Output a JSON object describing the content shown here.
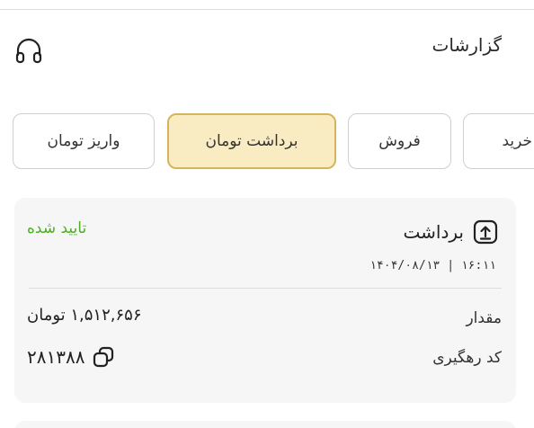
{
  "header": {
    "title": "گزارشات",
    "support_icon": "headphones-icon"
  },
  "tabs": [
    {
      "key": "deposit",
      "label": "واریز تومان",
      "active": false
    },
    {
      "key": "withdraw",
      "label": "برداشت تومان",
      "active": true
    },
    {
      "key": "sale",
      "label": "فروش",
      "active": false
    },
    {
      "key": "buy",
      "label": "خرید",
      "active": false
    }
  ],
  "colors": {
    "active_tab_bg": "#f9ecc3",
    "active_tab_border": "#d5b45c",
    "status_green": "#4caf26",
    "card_bg": "#f6f6f6"
  },
  "transaction": {
    "type_label": "برداشت",
    "type_icon": "upload-arrow-icon",
    "status": "تایید شده",
    "datetime": "۱۴۰۴/۰۸/۱۳ | ۱۶:۱۱",
    "amount_label": "مقدار",
    "amount_value": "۱,۵۱۲,۶۵۶ تومان",
    "code_label": "کد رهگیری",
    "code_value": "۲۸۱۳۸۸",
    "copy_icon": "copy-icon"
  }
}
